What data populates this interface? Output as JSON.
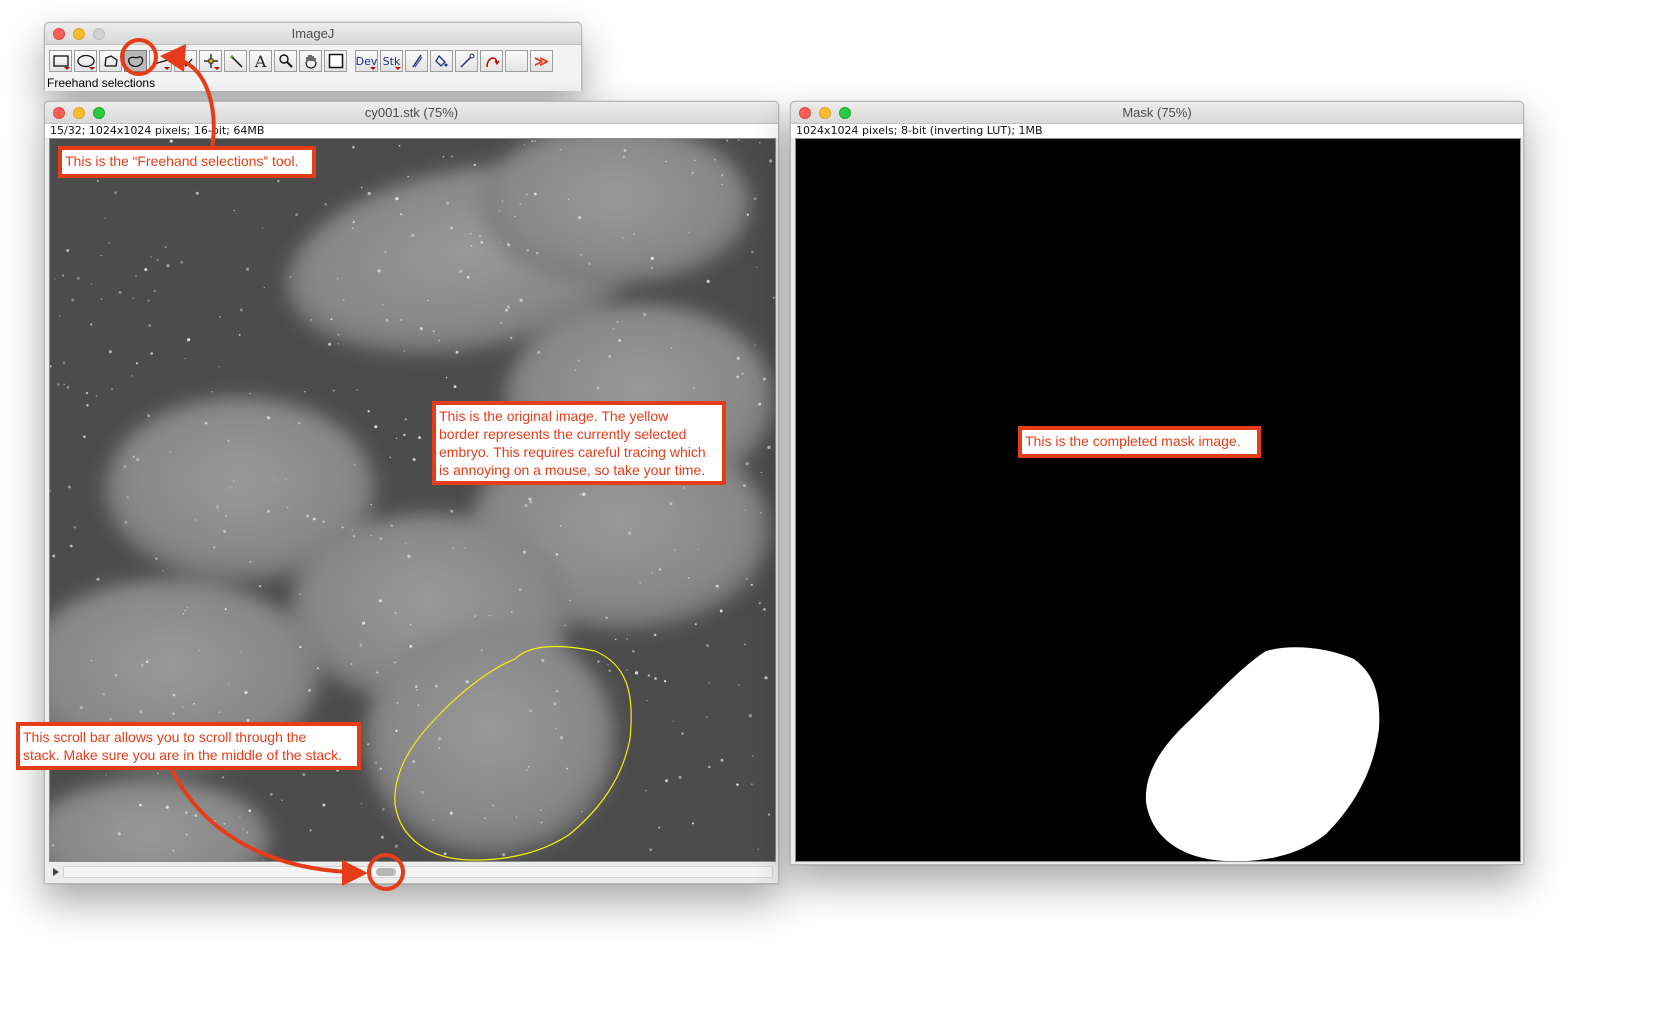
{
  "imagej_window": {
    "title": "ImageJ",
    "status_text": "Freehand selections",
    "tools": [
      {
        "name": "rectangle-tool-icon"
      },
      {
        "name": "oval-tool-icon"
      },
      {
        "name": "polygon-tool-icon"
      },
      {
        "name": "freehand-tool-icon"
      },
      {
        "name": "straight-line-tool-icon"
      },
      {
        "name": "angle-tool-icon"
      },
      {
        "name": "point-tool-icon"
      },
      {
        "name": "wand-tool-icon"
      },
      {
        "name": "text-tool-icon"
      },
      {
        "name": "magnifying-glass-icon"
      },
      {
        "name": "scrolling-hand-icon"
      },
      {
        "name": "color-picker-icon"
      }
    ],
    "dev_label": "Dev",
    "stk_label": "Stk",
    "more_label": "≫"
  },
  "stack_window": {
    "title": "cy001.stk (75%)",
    "info": "15/32; 1024x1024 pixels; 16-bit; 64MB"
  },
  "mask_window": {
    "title": "Mask (75%)",
    "info": "1024x1024 pixels; 8-bit (inverting LUT); 1MB"
  },
  "annotations": {
    "freehand_tool": "This is the “Freehand selections” tool.",
    "original_image": [
      "This is the original image. The yellow",
      "border represents the currently selected",
      "embryo. This requires careful tracing which",
      "is annoying on a mouse, so take your time."
    ],
    "mask_image": "This is the completed mask image.",
    "scroll_bar": [
      "This scroll bar allows you to scroll through the",
      "stack. Make sure you are in the middle of the stack."
    ]
  },
  "colors": {
    "annotation_red": "#e53d19",
    "selection_yellow": "#f2f20a",
    "mask_background": "#000000",
    "mask_foreground": "#ffffff"
  }
}
